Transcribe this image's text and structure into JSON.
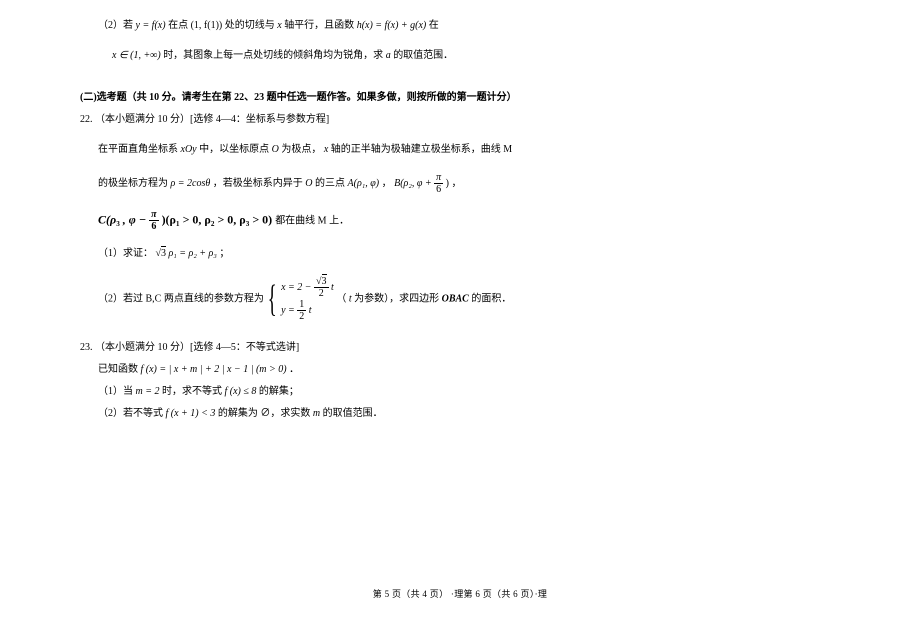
{
  "q21": {
    "part2_a": "（2）若 ",
    "part2_b": " 在点 ",
    "part2_c": " 处的切线与 ",
    "part2_d": " 轴平行，且函数 ",
    "part2_e": " 在",
    "part2_f": " 时，其图象上每一点处切线的倾斜角均为锐角，求 ",
    "part2_g": " 的取值范围．",
    "eq_yfx": "y = f(x)",
    "eq_point": "(1, f(1))",
    "eq_x": "x",
    "eq_hx": "h(x) = f(x) + g(x)",
    "eq_domain": "x ∈ (1, +∞)",
    "eq_a": "a"
  },
  "section2_header": "(二)选考题（共 10 分。请考生在第 22、23 题中任选一题作答。如果多做，则按所做的第一题计分）",
  "q22": {
    "num": "22.",
    "header": "（本小题满分 10 分）[选修 4—4：坐标系与参数方程]",
    "p1_a": "在平面直角坐标系 ",
    "p1_b": " 中，以坐标原点 ",
    "p1_c": " 为极点，",
    "p1_d": " 轴的正半轴为极轴建立极坐标系，曲线 M",
    "xoy": "xOy",
    "O": "O",
    "x": "x",
    "p2_a": "的极坐标方程为 ",
    "p2_b": " ，若极坐标系内异于 ",
    "p2_c": " 的三点 ",
    "rho2cos": "ρ = 2cosθ",
    "ptA": "A(ρ₁, φ)",
    "ptB_a": "B(ρ₂, φ + ",
    "ptB_c": ")",
    "pi": "π",
    "six": "6",
    "p2_e": "，",
    "p3_a": "C(ρ",
    "p3_sub3": "₃",
    "p3_b": ", φ − ",
    "p3_c": ")(ρ",
    "p3_sub1": "₁",
    "p3_d": " > 0, ρ",
    "p3_sub2": "₂",
    "p3_e": " > 0, ρ",
    "p3_f": " > 0) ",
    "p3_g": "都在曲线 M 上．",
    "part1": "（1）求证：",
    "sqrt3": "3",
    "proof_a": "ρ₁ = ρ₂ + ρ₃",
    "proof_end": "；",
    "part2_a": "（2）若过 B,C 两点直线的参数方程为",
    "part2_xa": "x = 2 − ",
    "part2_xb": "t",
    "sqrt3_num": "3",
    "two": "2",
    "part2_ya": "y = ",
    "one": "1",
    "part2_t": "t",
    "part2_c": "（",
    "part2_d": " 为参数），求四边形 ",
    "obac": "OBAC",
    "part2_e": " 的面积．",
    "t_var": "t"
  },
  "q23": {
    "num": "23.",
    "header": "（本小题满分 10 分）[选修 4—5：不等式选讲]",
    "p1_a": "已知函数 ",
    "fx_def": "f (x) = | x + m | + 2 | x − 1 | (m > 0)",
    "p1_b": "．",
    "part1_a": "（1）当 ",
    "m2": "m = 2",
    "part1_b": " 时，求不等式 ",
    "fx8": "f (x) ≤ 8",
    "part1_c": " 的解集；",
    "part2_a": "（2）若不等式 ",
    "fx13": "f (x + 1) < 3",
    "part2_b": " 的解集为 ∅，求实数 ",
    "m": "m",
    "part2_c": " 的取值范围．"
  },
  "footer": "第 5 页（共 4 页） ·理第 6 页（共 6 页）·理"
}
